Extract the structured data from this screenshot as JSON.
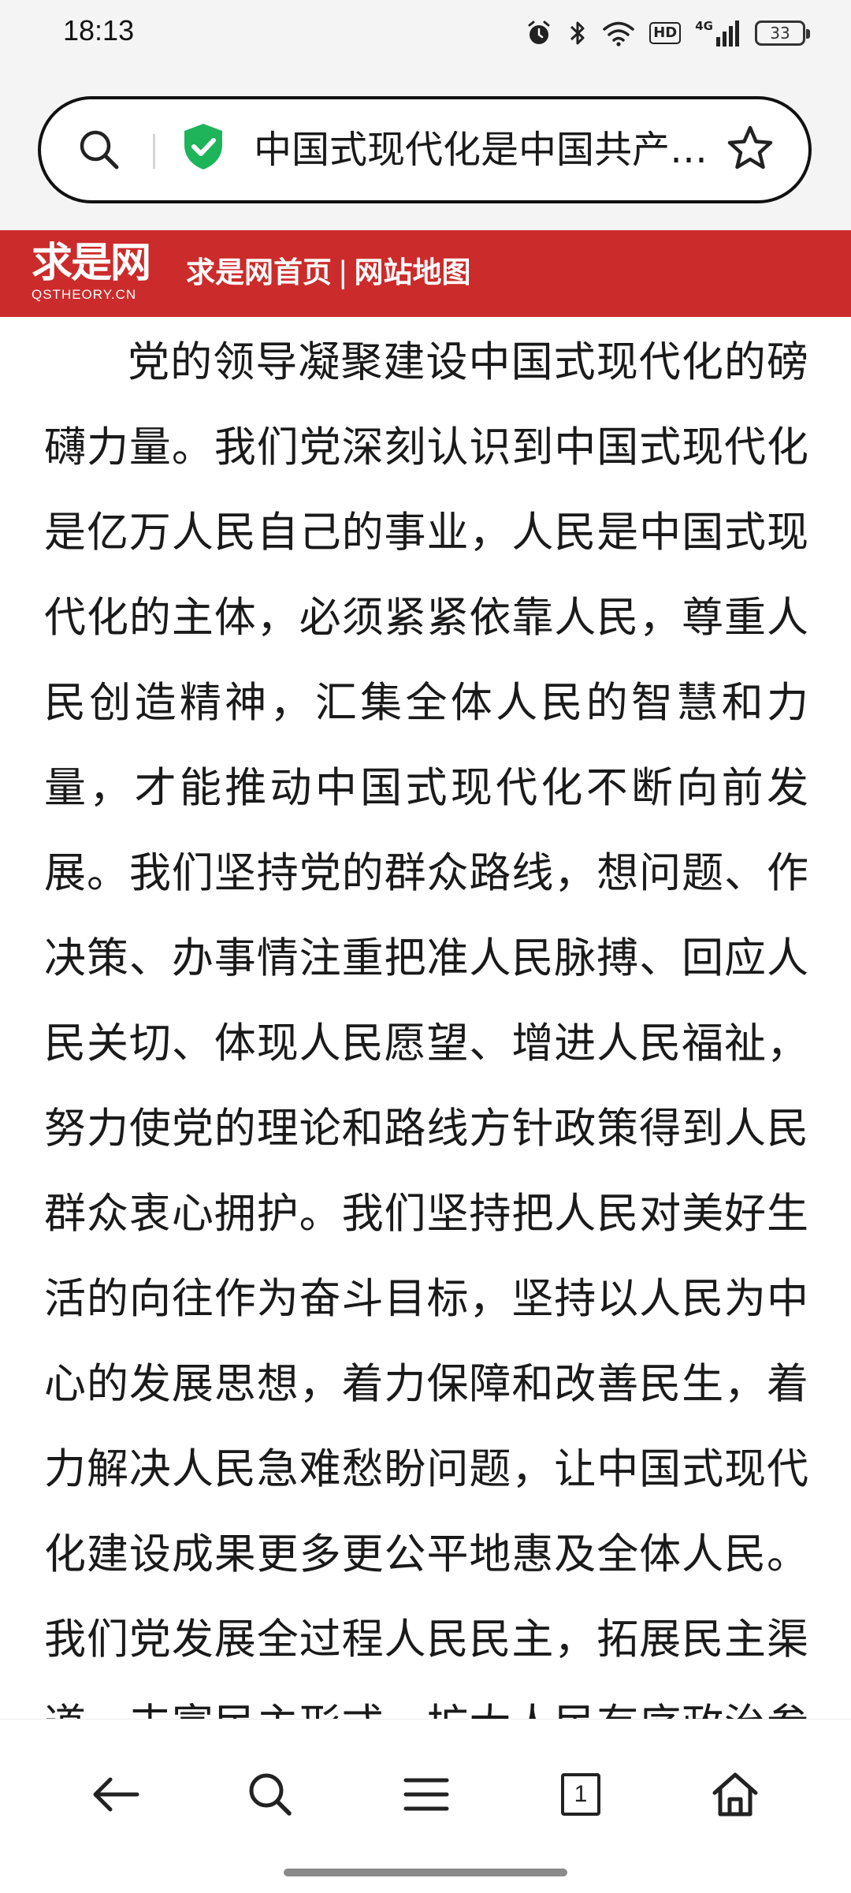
{
  "status_bar": {
    "time": "18:13",
    "battery": "33",
    "network": "4G",
    "hd_label": "HD",
    "icons": [
      "alarm-icon",
      "bluetooth-icon",
      "wifi-icon",
      "hd-icon",
      "signal-icon",
      "battery-icon"
    ]
  },
  "address_bar": {
    "url_text": "中国式现代化是中国共产…",
    "search_icon": "search-icon",
    "secure_icon": "shield-check-icon",
    "bookmark_icon": "star-icon",
    "secure_color": "#1db45a"
  },
  "site_header": {
    "logo_text": "求是网",
    "logo_subtext": "QSTHEORY.CN",
    "link_home": "求是网首页",
    "separator": "|",
    "link_sitemap": "网站地图",
    "background_color": "#cc2b2b"
  },
  "article": {
    "paragraph": "党的领导凝聚建设中国式现代化的磅礴力量。我们党深刻认识到中国式现代化是亿万人民自己的事业，人民是中国式现代化的主体，必须紧紧依靠人民，尊重人民创造精神，汇集全体人民的智慧和力量，才能推动中国式现代化不断向前发展。我们坚持党的群众路线，想问题、作决策、办事情注重把准人民脉搏、回应人民关切、体现人民愿望、增进人民福祉，努力使党的理论和路线方针政策得到人民群众衷心拥护。我们坚持把人民对美好生活的向往作为奋斗目标，坚持以人民为中心的发展思想，着力保障和改善民生，着力解决人民急难愁盼问题，让中国式现代化建设成果更多更公平地惠及全体人民。我们党发展全过程人民民主，拓展民主渠道，丰富民主形式，扩大人民有序政治参与"
  },
  "bottom_nav": {
    "tab_count": "1",
    "icons": [
      "back-arrow-icon",
      "search-icon",
      "menu-icon",
      "tabs-icon",
      "home-icon"
    ]
  }
}
